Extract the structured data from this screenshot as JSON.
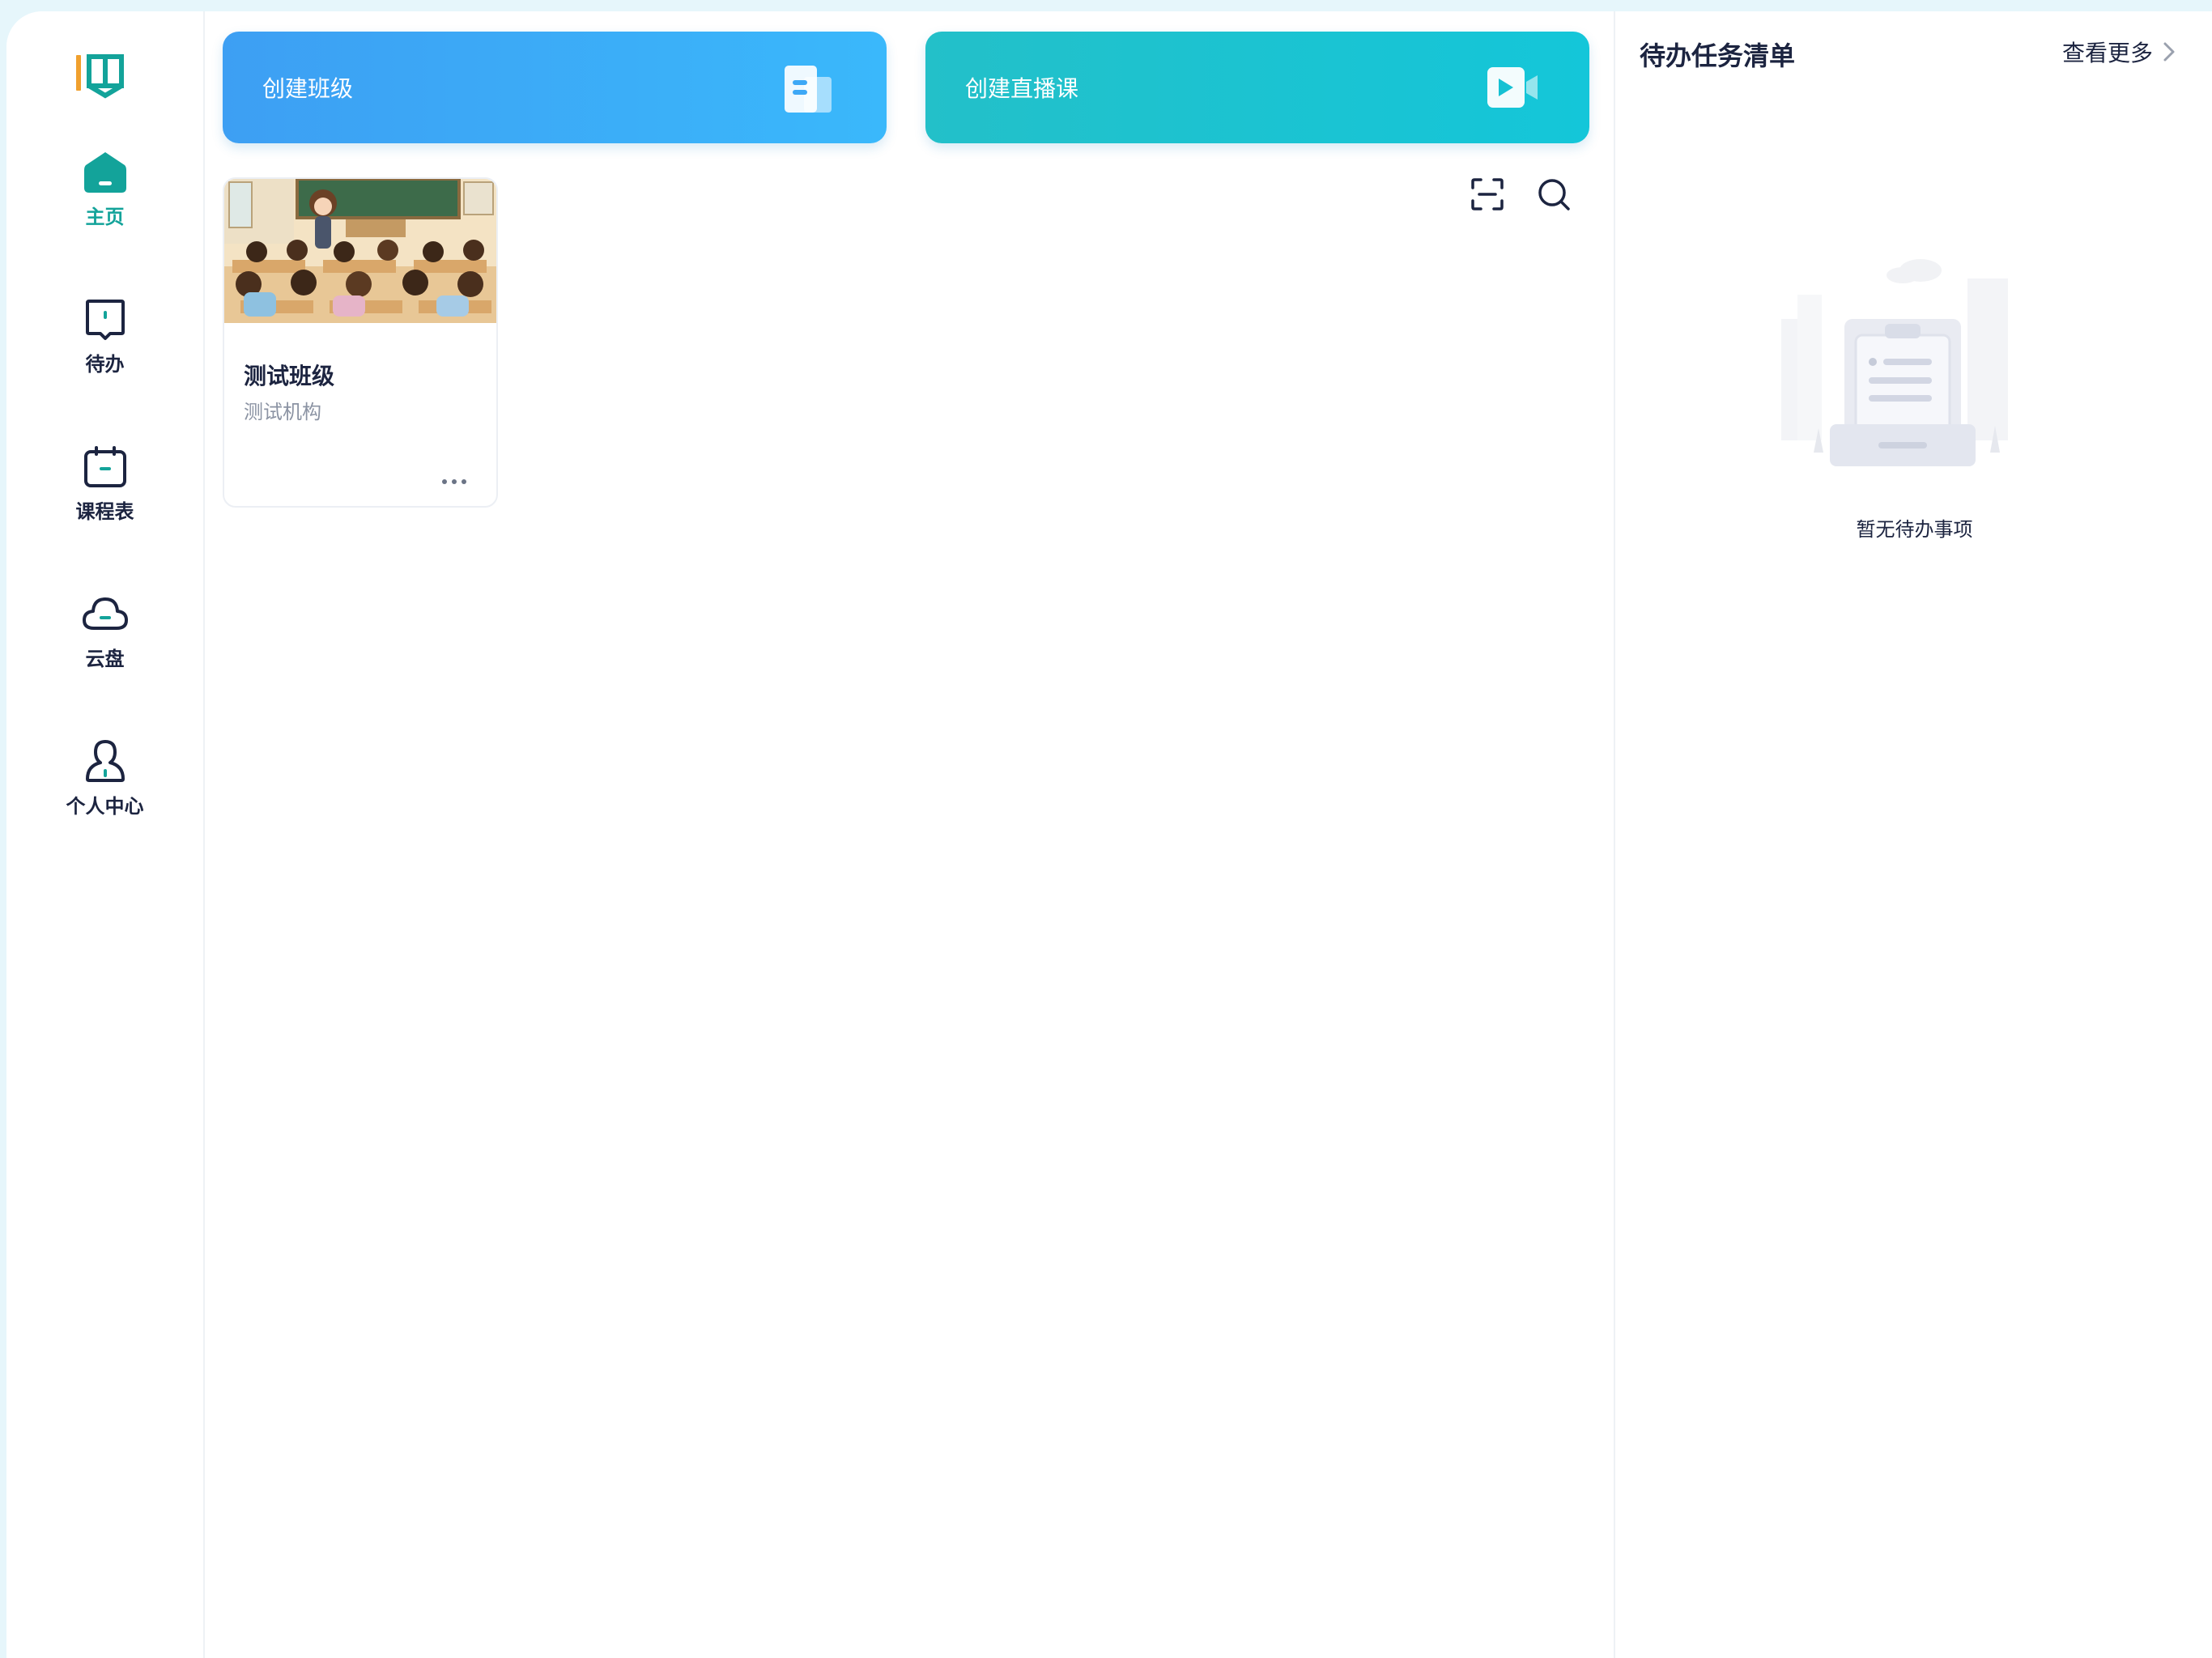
{
  "sidebar": {
    "logo": {
      "text": "1",
      "icon": "book-logo-icon"
    },
    "items": [
      {
        "label": "主页",
        "icon": "home-icon",
        "active": true
      },
      {
        "label": "待办",
        "icon": "book-todo-icon",
        "active": false
      },
      {
        "label": "课程表",
        "icon": "calendar-icon",
        "active": false
      },
      {
        "label": "云盘",
        "icon": "cloud-icon",
        "active": false
      },
      {
        "label": "个人中心",
        "icon": "user-icon",
        "active": false
      }
    ]
  },
  "main": {
    "banners": [
      {
        "label": "创建班级",
        "icon": "building-icon",
        "color": "#3ab0f8"
      },
      {
        "label": "创建直播课",
        "icon": "video-icon",
        "color": "#1ac3d5"
      }
    ],
    "tools": [
      {
        "icon": "scan-icon"
      },
      {
        "icon": "search-icon"
      }
    ],
    "classes": [
      {
        "name": "测试班级",
        "org": "测试机构",
        "image": "classroom-illustration",
        "more": "more-icon"
      }
    ]
  },
  "right_panel": {
    "title": "待办任务清单",
    "view_more": "查看更多",
    "empty_text": "暂无待办事项",
    "empty_image": "empty-clipboard-illustration"
  },
  "colors": {
    "accent": "#13a39a",
    "text": "#1c2440",
    "muted": "#8b93a3",
    "background": "#e6f6fb"
  }
}
